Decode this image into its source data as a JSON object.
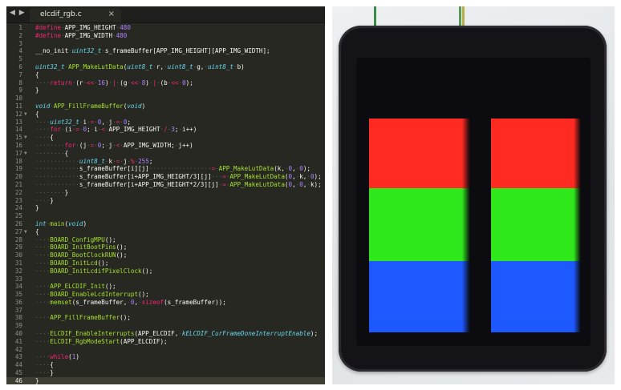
{
  "editor": {
    "tab_title": "elcdif_rgb.c",
    "close_glyph": "×",
    "nav_arrows": "◀ ▶",
    "lines": [
      {
        "n": "1"
      },
      {
        "n": "2"
      },
      {
        "n": "3"
      },
      {
        "n": "4"
      },
      {
        "n": "5"
      },
      {
        "n": "6"
      },
      {
        "n": "7"
      },
      {
        "n": "8"
      },
      {
        "n": "9"
      },
      {
        "n": "10"
      },
      {
        "n": "11"
      },
      {
        "n": "12",
        "fold": "▼"
      },
      {
        "n": "13"
      },
      {
        "n": "14"
      },
      {
        "n": "15",
        "fold": "▼"
      },
      {
        "n": "16"
      },
      {
        "n": "17",
        "fold": "▼"
      },
      {
        "n": "18"
      },
      {
        "n": "19"
      },
      {
        "n": "20"
      },
      {
        "n": "21"
      },
      {
        "n": "22"
      },
      {
        "n": "23"
      },
      {
        "n": "24"
      },
      {
        "n": "25"
      },
      {
        "n": "26"
      },
      {
        "n": "27",
        "fold": "▼"
      },
      {
        "n": "28"
      },
      {
        "n": "29"
      },
      {
        "n": "30"
      },
      {
        "n": "31"
      },
      {
        "n": "32"
      },
      {
        "n": "33"
      },
      {
        "n": "34"
      },
      {
        "n": "35"
      },
      {
        "n": "36"
      },
      {
        "n": "37"
      },
      {
        "n": "38"
      },
      {
        "n": "39"
      },
      {
        "n": "40"
      },
      {
        "n": "41"
      },
      {
        "n": "42"
      },
      {
        "n": "43"
      },
      {
        "n": "44"
      },
      {
        "n": "45"
      },
      {
        "n": "46",
        "current": true
      }
    ],
    "code": {
      "l1_kw": "#define",
      "l1_name": "APP_IMG_HEIGHT",
      "l1_val": "480",
      "l2_kw": "#define",
      "l2_name": "APP_IMG_WIDTH",
      "l2_val": "480",
      "l4_a": "__no_init",
      "l4_t": "uint32_t",
      "l4_b": "s_frameBuffer[APP_IMG_HEIGHT][APP_IMG_WIDTH];",
      "l6_t1": "uint32_t",
      "l6_f": "APP_MakeLutData",
      "l6_p1": "(",
      "l6_t2": "uint8_t",
      "l6_a": "r,",
      "l6_t3": "uint8_t",
      "l6_b": "g,",
      "l6_t4": "uint8_t",
      "l6_c": "b)",
      "l7": "{",
      "l8_kw": "return",
      "l8_a": "(r",
      "l8_op1": "<<",
      "l8_n1": "16",
      "l8_b": ")",
      "l8_op2": "|",
      "l8_c": "(g",
      "l8_op3": "<<",
      "l8_n2": "8",
      "l8_d": ")",
      "l8_op4": "|",
      "l8_e": "(b",
      "l8_op5": "<<",
      "l8_n3": "0",
      "l8_f": ");",
      "l9": "}",
      "l11_t": "void",
      "l11_f": "APP_FillFrameBuffer",
      "l11_p": "(",
      "l11_t2": "void",
      "l11_q": ")",
      "l12": "{",
      "l13_t": "uint32_t",
      "l13_a": "i",
      "l13_op1": "=",
      "l13_n1": "0",
      "l13_b": ",",
      "l13_c": "j",
      "l13_op2": "=",
      "l13_n2": "0",
      "l13_d": ";",
      "l14_kw": "for",
      "l14_a": "(i",
      "l14_op1": "=",
      "l14_n1": "0",
      "l14_b": ";",
      "l14_c": "i",
      "l14_op2": "<",
      "l14_d": "APP_IMG_HEIGHT",
      "l14_op3": "/",
      "l14_n2": "3",
      "l14_e": ";",
      "l14_f": "i++)",
      "l15": "{",
      "l16_kw": "for",
      "l16_a": "(j",
      "l16_op1": "=",
      "l16_n1": "0",
      "l16_b": ";",
      "l16_c": "j",
      "l16_op2": "<",
      "l16_d": "APP_IMG_WIDTH;",
      "l16_e": "j++)",
      "l17": "{",
      "l18_t": "uint8_t",
      "l18_a": "k",
      "l18_op1": "=",
      "l18_b": "j",
      "l18_op2": "%",
      "l18_n": "255",
      "l18_c": ";",
      "l19_a": "s_frameBuffer[i][j]",
      "l19_op": "=",
      "l19_f": "APP_MakeLutData",
      "l19_b": "(k,",
      "l19_n1": "0",
      "l19_c": ",",
      "l19_n2": "0",
      "l19_d": ");",
      "l20_a": "s_frameBuffer[i+APP_IMG_HEIGHT/3][j]",
      "l20_op": "=",
      "l20_f": "APP_MakeLutData",
      "l20_b": "(",
      "l20_n1": "0",
      "l20_c": ",",
      "l20_d": "k,",
      "l20_n2": "0",
      "l20_e": ");",
      "l21_a": "s_frameBuffer[i+APP_IMG_HEIGHT*2/3][j]",
      "l21_op": "=",
      "l21_f": "APP_MakeLutData",
      "l21_b": "(",
      "l21_n1": "0",
      "l21_c": ",",
      "l21_n2": "0",
      "l21_d": ",",
      "l21_e": "k);",
      "l22": "}",
      "l23": "}",
      "l24": "}",
      "l26_t": "int",
      "l26_f": "main",
      "l26_p": "(",
      "l26_t2": "void",
      "l26_q": ")",
      "l27": "{",
      "l28_f": "BOARD_ConfigMPU",
      "l28_r": "();",
      "l29_f": "BOARD_InitBootPins",
      "l29_r": "();",
      "l30_f": "BOARD_BootClockRUN",
      "l30_r": "();",
      "l31_f": "BOARD_InitLcd",
      "l31_r": "();",
      "l32_f": "BOARD_InitLcdifPixelClock",
      "l32_r": "();",
      "l34_f": "APP_ELCDIF_Init",
      "l34_r": "();",
      "l35_f": "BOARD_EnableLcdInterrupt",
      "l35_r": "();",
      "l36_f": "memset",
      "l36_a": "(s_frameBuffer,",
      "l36_n": "0",
      "l36_b": ",",
      "l36_k": "sizeof",
      "l36_c": "(s_frameBuffer));",
      "l38_f": "APP_FillFrameBuffer",
      "l38_r": "();",
      "l40_f": "ELCDIF_EnableInterrupts",
      "l40_a": "(APP_ELCDIF,",
      "l40_c": "kELCDIF_CurFrameDoneInterruptEnable",
      "l40_b": ");",
      "l41_f": "ELCDIF_RgbModeStart",
      "l41_a": "(APP_ELCDIF);",
      "l43_kw": "while",
      "l43_a": "(",
      "l43_n": "1",
      "l43_b": ")",
      "l44": "{",
      "l45": "}",
      "l46": "}"
    }
  },
  "photo": {
    "panel_colors": [
      "#ff2a22",
      "#2ee81c",
      "#1e58ff"
    ]
  }
}
